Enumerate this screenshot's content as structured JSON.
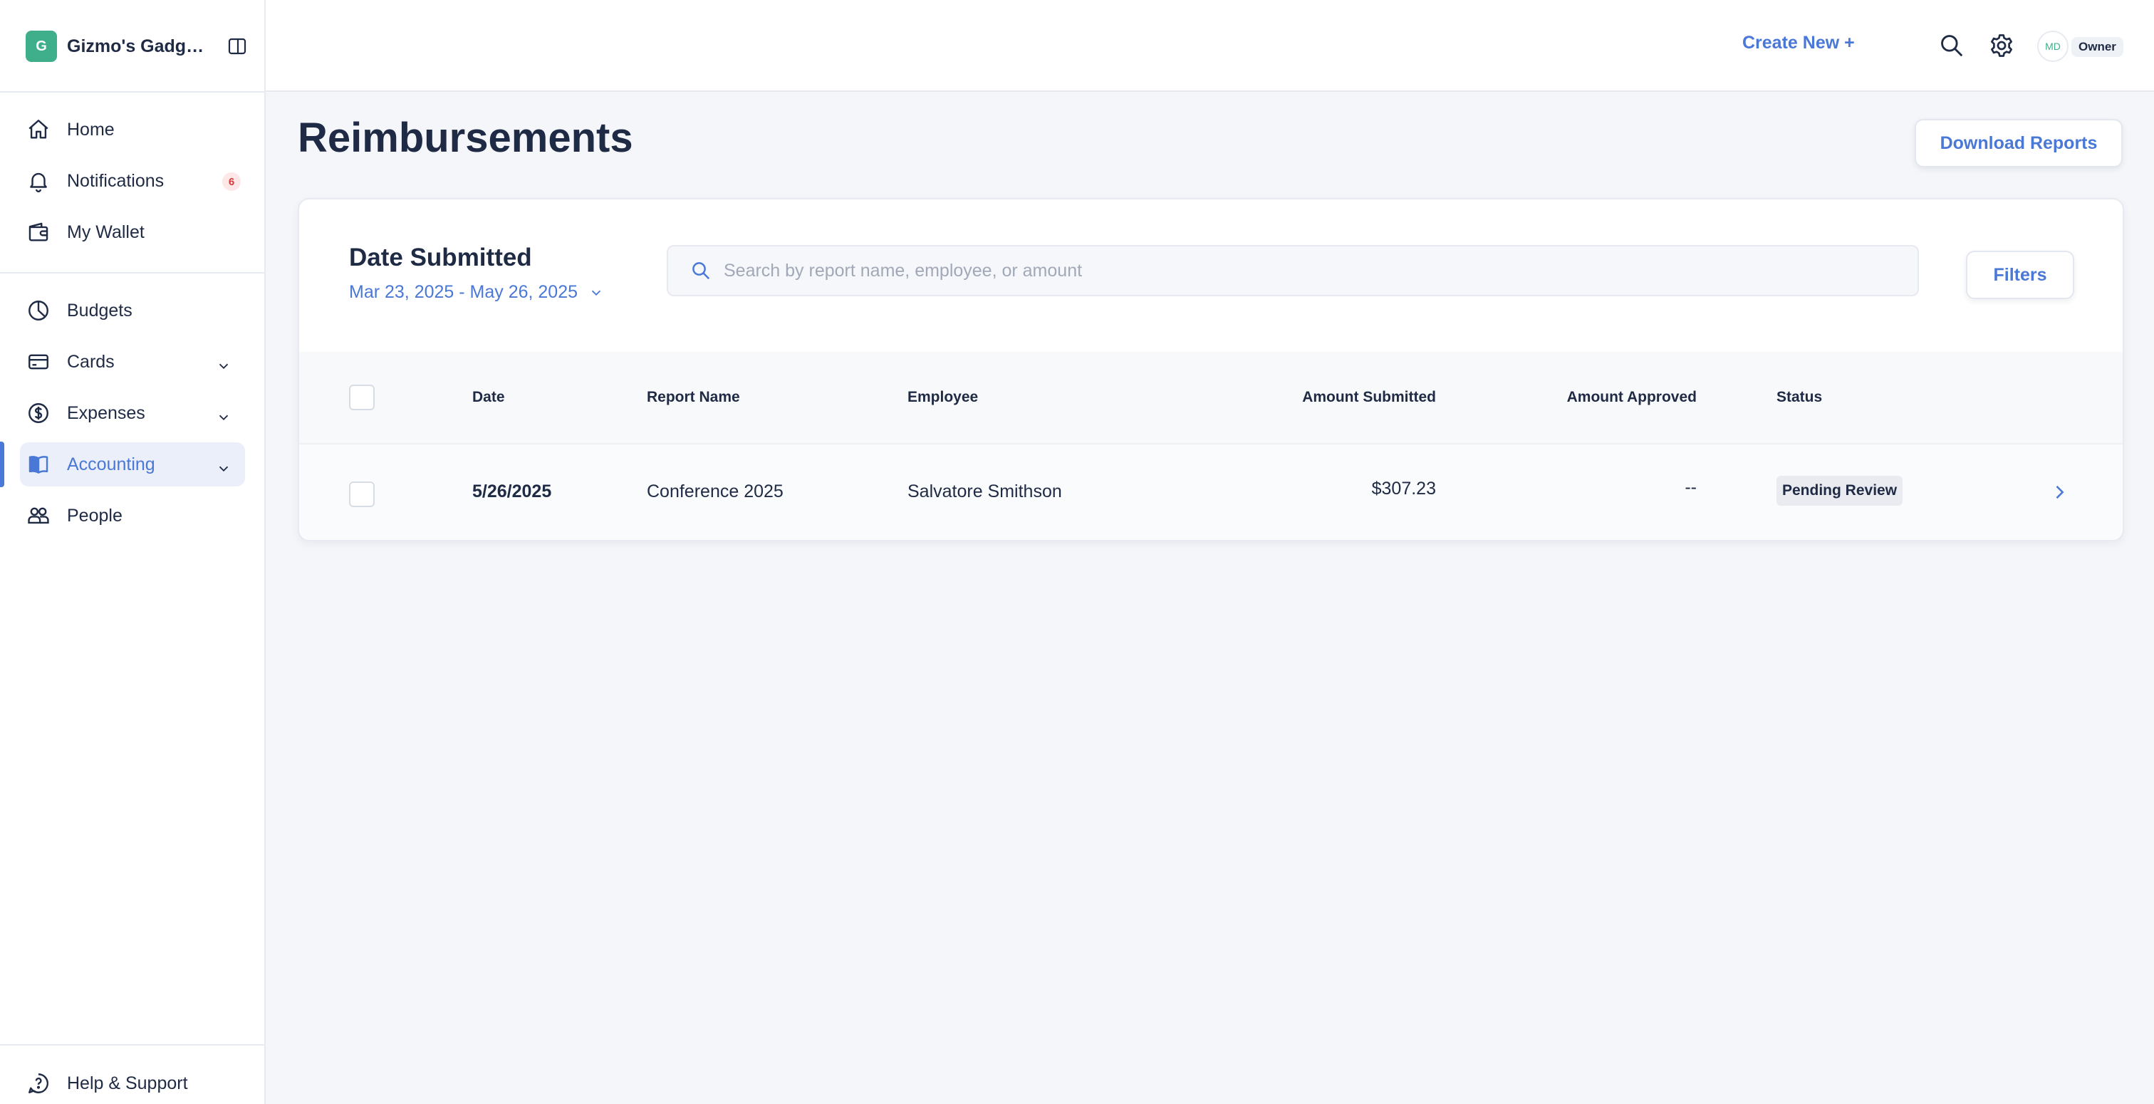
{
  "sidebar": {
    "brand": {
      "logo_letter": "G",
      "name": "Gizmo's Gadgets",
      "logo_color": "#3fae8a"
    },
    "items": [
      {
        "label": "Home",
        "icon": "home-icon"
      },
      {
        "label": "Notifications",
        "icon": "bell-icon",
        "badge": "6"
      },
      {
        "label": "My Wallet",
        "icon": "wallet-icon"
      },
      {
        "label": "Budgets",
        "icon": "pie-chart-icon"
      },
      {
        "label": "Cards",
        "icon": "credit-card-icon",
        "expandable": true
      },
      {
        "label": "Expenses",
        "icon": "dollar-circle-icon",
        "expandable": true
      },
      {
        "label": "Accounting",
        "icon": "book-icon",
        "expandable": true,
        "active": true
      },
      {
        "label": "People",
        "icon": "people-icon"
      }
    ],
    "help_label": "Help & Support"
  },
  "topbar": {
    "create_new": "Create New +",
    "avatar_initials": "MD",
    "role": "Owner"
  },
  "page": {
    "title": "Reimbursements",
    "download_button": "Download Reports"
  },
  "filter": {
    "title": "Date Submitted",
    "date_range": "Mar 23, 2025 - May 26, 2025",
    "search_placeholder": "Search by report name, employee, or amount",
    "search_value": "",
    "filters_button": "Filters"
  },
  "table": {
    "columns": [
      "Date",
      "Report Name",
      "Employee",
      "Amount Submitted",
      "Amount Approved",
      "Status"
    ],
    "rows": [
      {
        "date": "5/26/2025",
        "report_name": "Conference 2025",
        "employee": "Salvatore Smithson",
        "amount_submitted": "$307.23",
        "amount_approved": "--",
        "status": "Pending Review"
      }
    ]
  },
  "colors": {
    "accent": "#4a78d6",
    "text": "#1f2a44",
    "background": "#f4f6fa",
    "badge_red": "#d53b3b"
  }
}
